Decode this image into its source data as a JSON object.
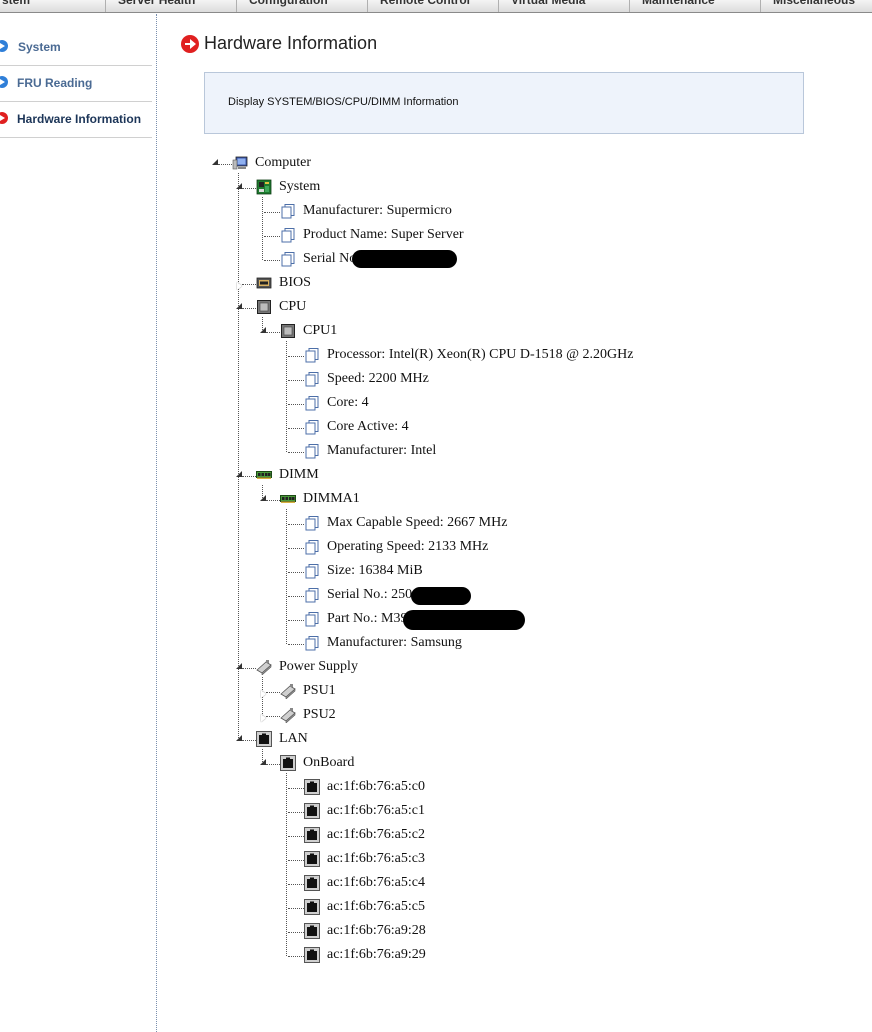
{
  "nav": {
    "tabs": [
      "stem",
      "Server Health",
      "Configuration",
      "Remote Control",
      "Virtual Media",
      "Maintenance",
      "Miscellaneous"
    ]
  },
  "sidebar": {
    "items": [
      {
        "label": "System",
        "active": false
      },
      {
        "label": "FRU Reading",
        "active": false
      },
      {
        "label": "Hardware Information",
        "active": true
      }
    ]
  },
  "page": {
    "title": "Hardware Information",
    "description": "Display SYSTEM/BIOS/CPU/DIMM Information"
  },
  "tree": {
    "root": "Computer",
    "system": {
      "label": "System",
      "manufacturer": "Manufacturer: Supermicro",
      "product": "Product Name: Super Server",
      "serial": "Serial No"
    },
    "bios": "BIOS",
    "cpu": {
      "label": "CPU",
      "cpu1": {
        "label": "CPU1",
        "items": [
          "Processor: Intel(R) Xeon(R) CPU D-1518 @ 2.20GHz",
          "Speed: 2200 MHz",
          "Core: 4",
          "Core Active: 4",
          "Manufacturer: Intel"
        ]
      }
    },
    "dimm": {
      "label": "DIMM",
      "dimma1": {
        "label": "DIMMA1",
        "items": [
          "Max Capable Speed: 2667 MHz",
          "Operating Speed: 2133 MHz",
          "Size: 16384 MiB",
          "Serial No.: 250",
          "Part No.: M39",
          "Manufacturer: Samsung"
        ]
      }
    },
    "power": {
      "label": "Power Supply",
      "psus": [
        "PSU1",
        "PSU2"
      ]
    },
    "lan": {
      "label": "LAN",
      "onboard": {
        "label": "OnBoard",
        "macs": [
          "ac:1f:6b:76:a5:c0",
          "ac:1f:6b:76:a5:c1",
          "ac:1f:6b:76:a5:c2",
          "ac:1f:6b:76:a5:c3",
          "ac:1f:6b:76:a5:c4",
          "ac:1f:6b:76:a5:c5",
          "ac:1f:6b:76:a9:28",
          "ac:1f:6b:76:a9:29"
        ]
      }
    }
  }
}
